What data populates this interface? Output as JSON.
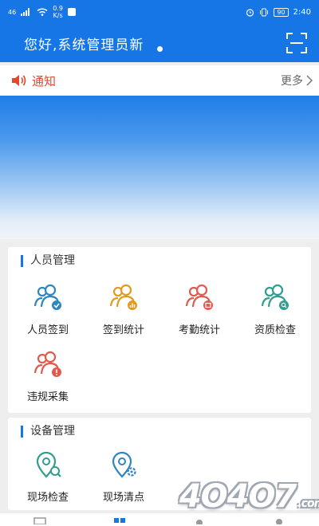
{
  "status_bar": {
    "network": "46",
    "speed_value": "0.9",
    "speed_unit": "K/s",
    "battery": "90",
    "time": "2:40"
  },
  "header": {
    "title": "您好,系统管理员新",
    "scan_icon": "scan-icon"
  },
  "notice": {
    "title": "通知",
    "more": "更多",
    "icon": "speaker-icon"
  },
  "people_section": {
    "title": "人员管理",
    "tiles": [
      {
        "label": "人员签到",
        "icon": "person-signin-icon",
        "color": "#2e86c1"
      },
      {
        "label": "签到统计",
        "icon": "signin-stats-icon",
        "color": "#e39b1f"
      },
      {
        "label": "考勤统计",
        "icon": "attendance-stats-icon",
        "color": "#e05a4e"
      },
      {
        "label": "资质检查",
        "icon": "qualification-check-icon",
        "color": "#2f9e8e"
      },
      {
        "label": "违规采集",
        "icon": "violation-collect-icon",
        "color": "#e05a4e"
      }
    ]
  },
  "device_section": {
    "title": "设备管理",
    "tiles": [
      {
        "label": "现场检查",
        "icon": "site-inspect-icon",
        "color": "#2f9e8e"
      },
      {
        "label": "现场清点",
        "icon": "site-count-icon",
        "color": "#2e86c1"
      }
    ]
  },
  "watermark": {
    "text": "4O4O7",
    "suffix": ".com"
  },
  "colors": {
    "primary": "#1676e5",
    "notice_red": "#e4472c"
  }
}
